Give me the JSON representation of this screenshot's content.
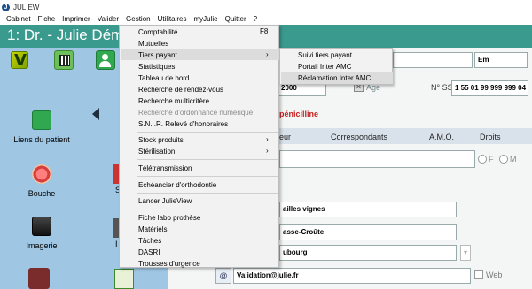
{
  "window": {
    "title": "JULIEW"
  },
  "menubar": [
    "Cabinet",
    "Fiche",
    "Imprimer",
    "Valider",
    "Gestion",
    "Utilitaires",
    "myJulie",
    "Quitter",
    "?"
  ],
  "header": {
    "patient_title": "1: Dr. - Julie Dém"
  },
  "sidebar": {
    "liens_label": "Liens du patient",
    "bouche_label": "Bouche",
    "imagerie_label": "Imagerie",
    "partial_s": "S",
    "partial_i": "I"
  },
  "gestion_menu": {
    "items": [
      {
        "label": "Comptabilité",
        "shortcut": "F8"
      },
      {
        "label": "Mutuelles"
      },
      {
        "label": "Tiers payant",
        "submenu": true
      },
      {
        "label": "Statistiques"
      },
      {
        "label": "Tableau de bord"
      },
      {
        "label": "Recherche de rendez-vous"
      },
      {
        "label": "Recherche multicritère"
      },
      {
        "label": "Recherche d'ordonnance numérique",
        "disabled": true
      },
      {
        "label": "S.N.I.R. Relevé d'honoraires"
      },
      {
        "label": "Stock produits",
        "submenu": true
      },
      {
        "label": "Stérilisation",
        "submenu": true
      },
      {
        "label": "Télétransmission"
      },
      {
        "label": "Echéancier d'orthodontie"
      },
      {
        "label": "Lancer JulieView"
      },
      {
        "label": "Fiche labo prothèse"
      },
      {
        "label": "Matériels"
      },
      {
        "label": "Tâches"
      },
      {
        "label": "DASRI"
      },
      {
        "label": "Trousses d'urgence"
      }
    ]
  },
  "tiers_payant_submenu": {
    "items": [
      {
        "label": "Suivi tiers payant"
      },
      {
        "label": "Portail Inter AMC"
      },
      {
        "label": "Réclamation Inter AMC"
      }
    ]
  },
  "patient": {
    "civility": "Em",
    "birth_year_partial": "2000",
    "age_label": "Age",
    "ss_label": "N° SS",
    "ss_number": "1 55 01 99 999 999 04",
    "allergy": "pénicilline",
    "gender_f": "F",
    "gender_m": "M",
    "address1": "ailles vignes",
    "address2": "asse-Croûte",
    "address3": "ubourg",
    "email_prefix": "@",
    "email": "Validation@julie.fr",
    "web_label": "Web"
  },
  "tabs": [
    "eur",
    "Correspondants",
    "A.M.O.",
    "Droits"
  ],
  "colors": {
    "header": "#3a9a8e",
    "sidebar": "#9fc6e3",
    "allergy": "#c62020",
    "menu_bg": "#f2f2f2"
  }
}
